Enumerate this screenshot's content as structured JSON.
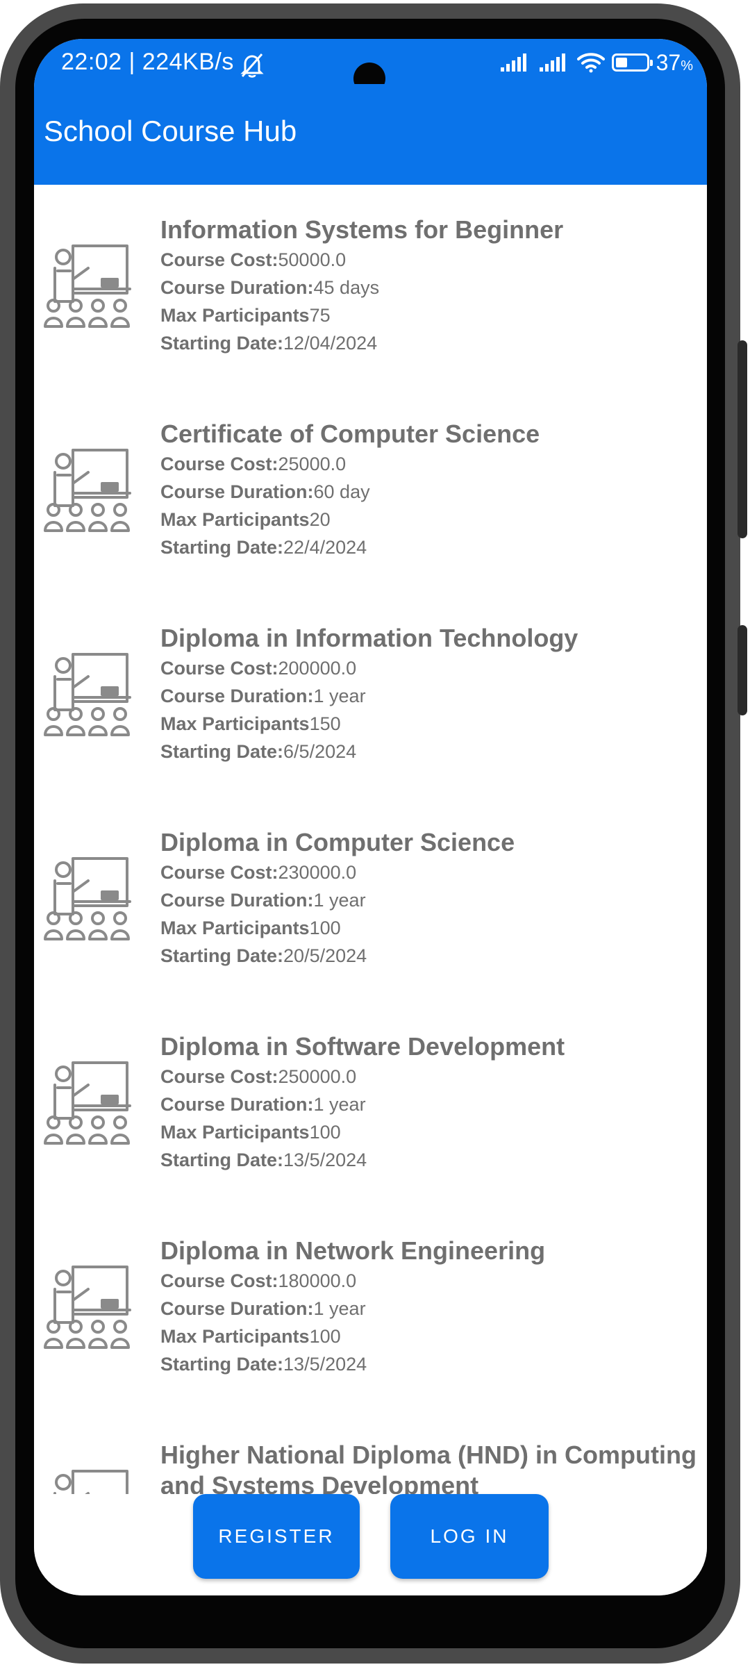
{
  "status_bar": {
    "time_speed": "22:02 | 224KB/s",
    "battery_level": "37",
    "battery_unit": "%",
    "battery_fraction": 0.37
  },
  "app_bar": {
    "title": "School Course Hub"
  },
  "courses": [
    {
      "title": "Information Systems for Beginner",
      "cost_label": "Course Cost:",
      "cost": "50000.0",
      "duration_label": "Course Duration:",
      "duration": "45 days",
      "participants_label": "Max Participants",
      "participants": "75",
      "start_label": "Starting Date:",
      "start": "12/04/2024"
    },
    {
      "title": "Certificate of Computer Science",
      "cost_label": "Course Cost:",
      "cost": "25000.0",
      "duration_label": "Course Duration:",
      "duration": "60 day",
      "participants_label": "Max Participants",
      "participants": "20",
      "start_label": "Starting Date:",
      "start": "22/4/2024"
    },
    {
      "title": "Diploma in Information Technology",
      "cost_label": "Course Cost:",
      "cost": "200000.0",
      "duration_label": "Course Duration:",
      "duration": "1 year",
      "participants_label": "Max Participants",
      "participants": "150",
      "start_label": "Starting Date:",
      "start": "6/5/2024"
    },
    {
      "title": "Diploma in Computer Science",
      "cost_label": "Course Cost:",
      "cost": "230000.0",
      "duration_label": "Course Duration:",
      "duration": "1 year",
      "participants_label": "Max Participants",
      "participants": "100",
      "start_label": "Starting Date:",
      "start": "20/5/2024"
    },
    {
      "title": "Diploma in Software Development",
      "cost_label": "Course Cost:",
      "cost": "250000.0",
      "duration_label": "Course Duration:",
      "duration": "1 year",
      "participants_label": "Max Participants",
      "participants": "100",
      "start_label": "Starting Date:",
      "start": "13/5/2024"
    },
    {
      "title": "Diploma in Network Engineering",
      "cost_label": "Course Cost:",
      "cost": "180000.0",
      "duration_label": "Course Duration:",
      "duration": "1 year",
      "participants_label": "Max Participants",
      "participants": "100",
      "start_label": "Starting Date:",
      "start": "13/5/2024"
    },
    {
      "title": "Higher National Diploma (HND) in Computing",
      "title_line2": "and Systems Development"
    }
  ],
  "buttons": {
    "register": "REGISTER",
    "login": "LOG IN"
  },
  "icons": {
    "course": "teacher-classroom-icon",
    "mute": "bell-muted-icon",
    "signal": "signal-bars-icon",
    "wifi": "wifi-icon",
    "battery": "battery-icon"
  },
  "colors": {
    "primary": "#0a74ea",
    "text_gray": "#6f6f6f",
    "phone_frame": "#4a4a4a"
  }
}
